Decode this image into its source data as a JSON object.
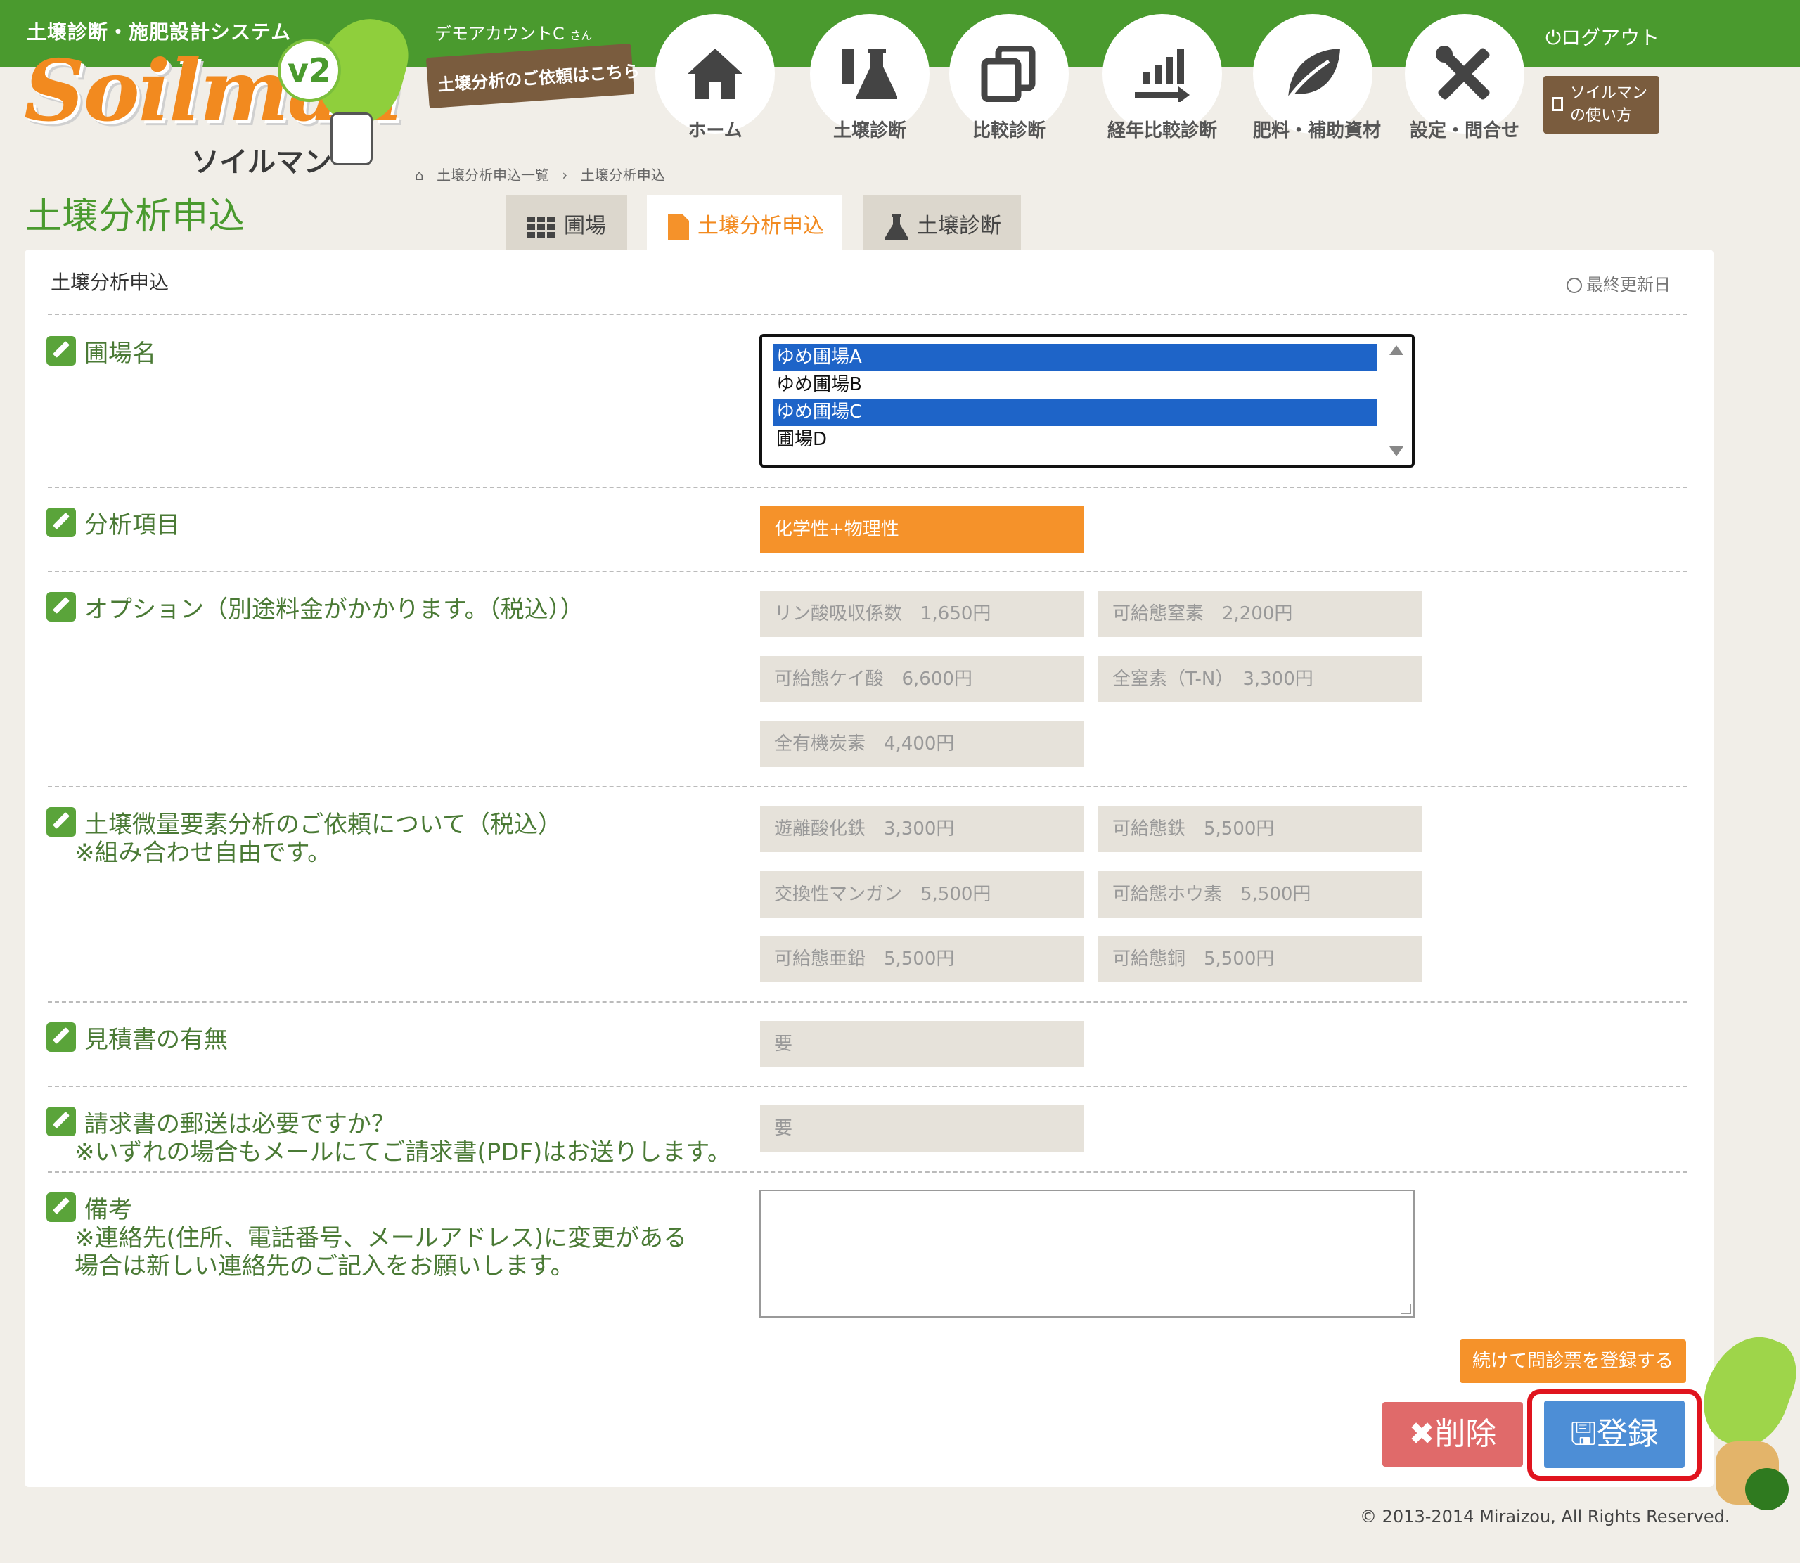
{
  "header": {
    "system_name": "土壌診断・施肥設計システム",
    "logo_text": "Soilman",
    "logo_version": "v2",
    "logo_kana": "ソイルマン",
    "account_name": "デモアカウントC",
    "account_suffix": "さん",
    "request_banner": "土壌分析のご依頼はこちら",
    "logout": "ログアウト",
    "manual_button": [
      "ソイルマン",
      "の使い方"
    ]
  },
  "nav": [
    {
      "label": "ホーム",
      "icon": "home-icon"
    },
    {
      "label": "土壌診断",
      "icon": "flask-icon"
    },
    {
      "label": "比較診断",
      "icon": "copy-icon"
    },
    {
      "label": "経年比較診断",
      "icon": "bar-chart-arrow-icon"
    },
    {
      "label": "肥料・補助資材",
      "icon": "leaf-icon"
    },
    {
      "label": "設定・問合せ",
      "icon": "tools-icon"
    }
  ],
  "breadcrumb": [
    "土壌分析申込一覧",
    "土壌分析申込"
  ],
  "page_title": "土壌分析申込",
  "tabs": [
    {
      "label": "圃場",
      "icon": "grid-icon"
    },
    {
      "label": "土壌分析申込",
      "icon": "document-icon",
      "active": true
    },
    {
      "label": "土壌診断",
      "icon": "flask-icon"
    }
  ],
  "panel": {
    "title": "土壌分析申込",
    "last_updated": "最終更新日"
  },
  "form": {
    "field": {
      "label": "圃場名",
      "options": [
        {
          "label": "ゆめ圃場A",
          "selected": true
        },
        {
          "label": "ゆめ圃場B",
          "selected": false
        },
        {
          "label": "ゆめ圃場C",
          "selected": true
        },
        {
          "label": "圃場D",
          "selected": false
        }
      ]
    },
    "analysis": {
      "label": "分析項目",
      "value": "化学性+物理性"
    },
    "options": {
      "label": "オプション（別途料金がかかります。（税込））",
      "items": [
        "リン酸吸収係数　1,650円",
        "可給態窒素　2,200円",
        "可給態ケイ酸　6,600円",
        "全窒素（T-N）　3,300円",
        "全有機炭素　4,400円"
      ]
    },
    "trace": {
      "label": "土壌微量要素分析のご依頼について（税込）",
      "note": "※組み合わせ自由です。",
      "items": [
        "遊離酸化鉄　3,300円",
        "可給態鉄　5,500円",
        "交換性マンガン　5,500円",
        "可給態ホウ素　5,500円",
        "可給態亜鉛　5,500円",
        "可給態銅　5,500円"
      ]
    },
    "estimate": {
      "label": "見積書の有無",
      "value": "要"
    },
    "invoice": {
      "label": "請求書の郵送は必要ですか？",
      "note": "※いずれの場合もメールにてご請求書(PDF)はお送りします。",
      "value": "要"
    },
    "remarks": {
      "label": "備考",
      "note1": "※連絡先(住所、電話番号、メールアドレス)に変更がある",
      "note2": "場合は新しい連絡先のご記入をお願いします。",
      "value": ""
    }
  },
  "buttons": {
    "continue": "続けて問診票を登録する",
    "delete": "削除",
    "register": "登録"
  },
  "copyright": "© 2013-2014 Miraizou, All Rights Reserved.",
  "colors": {
    "brand_green": "#4a9a2e",
    "accent_orange": "#f5922a",
    "select_blue": "#1e64c8",
    "delete_red": "#e06a6a",
    "register_blue": "#4d8ed6",
    "highlight_red": "#e0141e"
  }
}
